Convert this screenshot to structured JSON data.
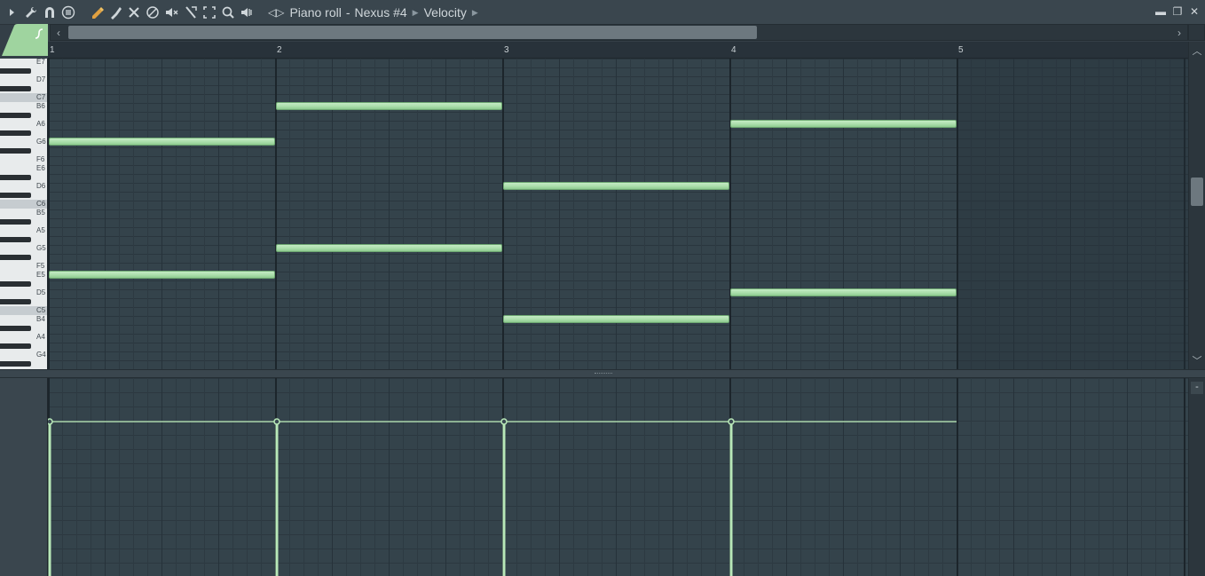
{
  "window": {
    "breadcrumb": [
      "Piano roll",
      "Nexus #4",
      "Velocity"
    ],
    "controls": {
      "minimize": "▬",
      "restore": "❐",
      "close": "✕"
    }
  },
  "toolbar": {
    "icons": [
      "menu-arrow-icon",
      "wrench-icon",
      "magnet-icon",
      "menu-list-icon",
      "pencil-icon",
      "paint-brush-icon",
      "delete-tool-icon",
      "mute-tool-icon",
      "speaker-mute-icon",
      "slice-tool-icon",
      "select-tool-icon",
      "zoom-icon",
      "playback-icon"
    ]
  },
  "ruler": {
    "bars": [
      "1",
      "2",
      "3",
      "4",
      "5"
    ]
  },
  "keyboard": {
    "labels": [
      "E7",
      "D7",
      "C7",
      "B6",
      "A6",
      "G6",
      "F6",
      "E6",
      "D6",
      "C6",
      "B5",
      "A5",
      "G5",
      "F5",
      "E5",
      "D5",
      "C5",
      "B4",
      "A4",
      "G4"
    ]
  },
  "notes": [
    {
      "key": "G6",
      "bar_start": 1,
      "length_bars": 1
    },
    {
      "key": "E5",
      "bar_start": 1,
      "length_bars": 1
    },
    {
      "key": "B6",
      "bar_start": 2,
      "length_bars": 1
    },
    {
      "key": "G5",
      "bar_start": 2,
      "length_bars": 1
    },
    {
      "key": "D6",
      "bar_start": 3,
      "length_bars": 1
    },
    {
      "key": "B4",
      "bar_start": 3,
      "length_bars": 1
    },
    {
      "key": "A6",
      "bar_start": 4,
      "length_bars": 1
    },
    {
      "key": "D5",
      "bar_start": 4,
      "length_bars": 1
    }
  ],
  "velocity": {
    "values": [
      0.78,
      0.78,
      0.78,
      0.78
    ]
  },
  "colors": {
    "note": "#a8dca8",
    "velocity_line": "#b8e8b8",
    "grid": "#34434b",
    "accent": "#9fd49f"
  }
}
